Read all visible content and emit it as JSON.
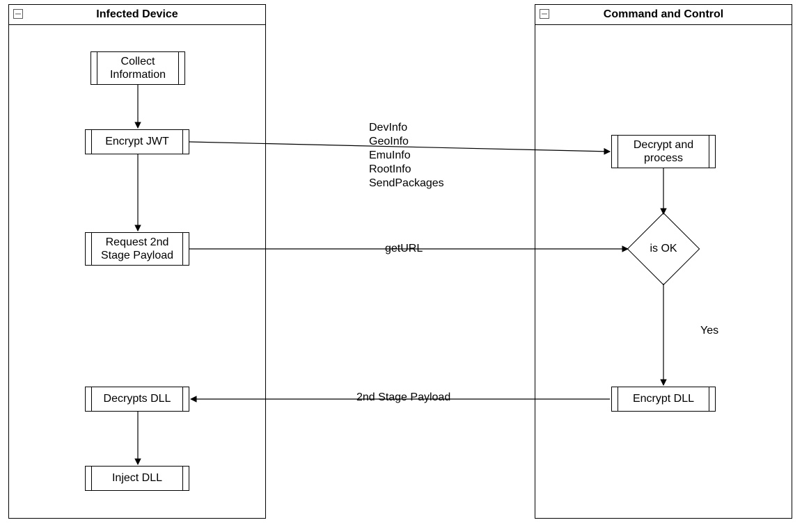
{
  "lanes": {
    "left": {
      "title": "Infected Device"
    },
    "right": {
      "title": "Command and Control"
    }
  },
  "nodes": {
    "collect": {
      "label": "Collect\nInformation"
    },
    "encrypt": {
      "label": "Encrypt JWT"
    },
    "request": {
      "label": "Request 2nd\nStage Payload"
    },
    "decryptsdll": {
      "label": "Decrypts DLL"
    },
    "injectdll": {
      "label": "Inject DLL"
    },
    "decryptproc": {
      "label": "Decrypt and\nprocess"
    },
    "isok": {
      "label": "is OK"
    },
    "encryptdll": {
      "label": "Encrypt DLL"
    }
  },
  "edgeLabels": {
    "devinfo": "DevInfo\nGeoInfo\nEmuInfo\nRootInfo\nSendPackages",
    "geturl": "getURL",
    "yes": "Yes",
    "payload": "2nd Stage Payload"
  }
}
